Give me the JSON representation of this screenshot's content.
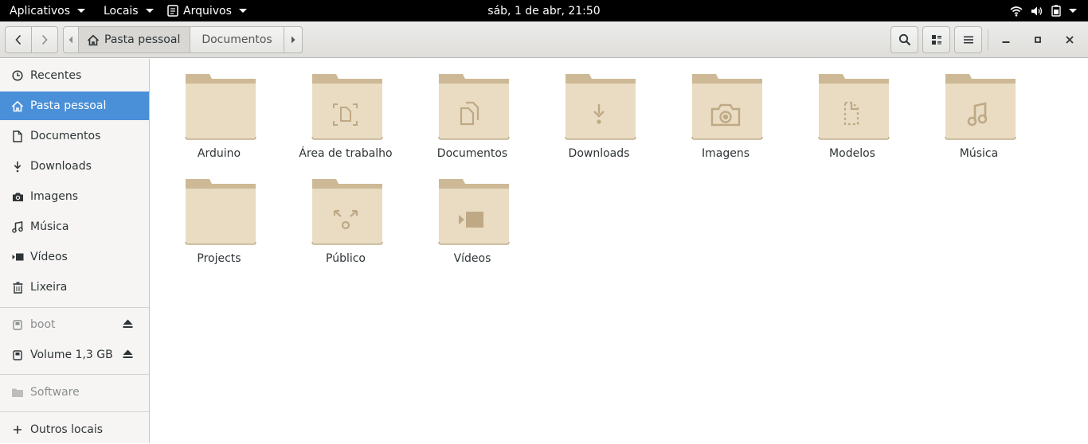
{
  "topbar": {
    "applications": "Aplicativos",
    "places": "Locais",
    "app_menu": "Arquivos",
    "clock": "sáb,  1 de abr, 21:50"
  },
  "pathbar": {
    "home_label": "Pasta pessoal",
    "next_label": "Documentos"
  },
  "sidebar": {
    "items": [
      {
        "label": "Recentes",
        "icon": "clock-icon"
      },
      {
        "label": "Pasta pessoal",
        "icon": "home-icon"
      },
      {
        "label": "Documentos",
        "icon": "document-icon"
      },
      {
        "label": "Downloads",
        "icon": "download-icon"
      },
      {
        "label": "Imagens",
        "icon": "camera-icon"
      },
      {
        "label": "Música",
        "icon": "music-icon"
      },
      {
        "label": "Vídeos",
        "icon": "video-icon"
      },
      {
        "label": "Lixeira",
        "icon": "trash-icon"
      }
    ],
    "devices": [
      {
        "label": "boot",
        "icon": "drive-icon"
      },
      {
        "label": "Volume 1,3 GB",
        "icon": "drive-icon"
      }
    ],
    "network": {
      "label": "Software",
      "icon": "folder-icon"
    },
    "other": {
      "label": "Outros locais",
      "icon": "plus-icon"
    }
  },
  "folders": [
    {
      "name": "Arduino",
      "emblem": "none"
    },
    {
      "name": "Área de trabalho",
      "emblem": "desktop"
    },
    {
      "name": "Documentos",
      "emblem": "documents"
    },
    {
      "name": "Downloads",
      "emblem": "download"
    },
    {
      "name": "Imagens",
      "emblem": "camera"
    },
    {
      "name": "Modelos",
      "emblem": "templates"
    },
    {
      "name": "Música",
      "emblem": "music"
    },
    {
      "name": "Projects",
      "emblem": "none"
    },
    {
      "name": "Público",
      "emblem": "share"
    },
    {
      "name": "Vídeos",
      "emblem": "video"
    }
  ],
  "colors": {
    "folder_fill": "#e9dcc3",
    "folder_tab": "#cdb995",
    "folder_emblem": "#bfa985",
    "selection": "#4a90d9"
  }
}
